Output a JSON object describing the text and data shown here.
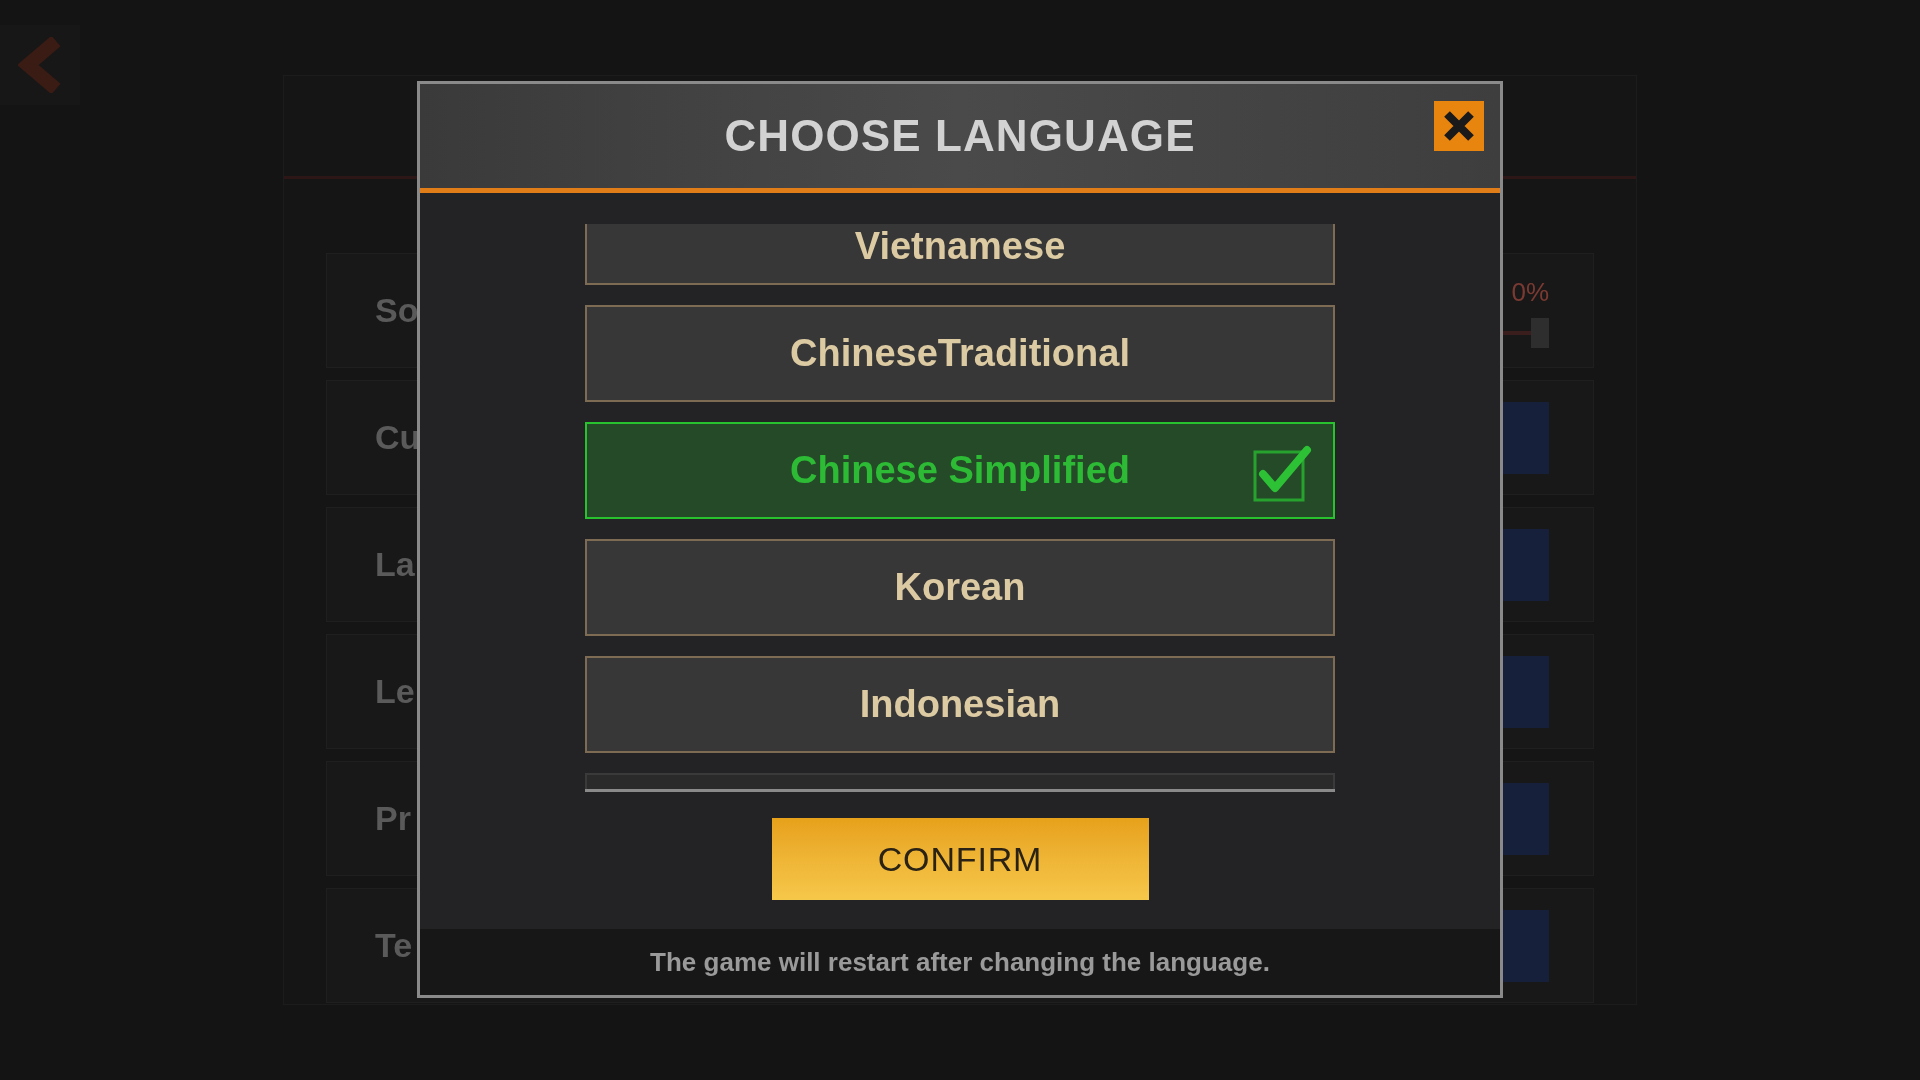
{
  "background_settings": {
    "rows": [
      {
        "label": "So",
        "kind": "slider",
        "reading": "0%",
        "level": 1
      },
      {
        "label": "Cu",
        "kind": "option"
      },
      {
        "label": "La",
        "kind": "option"
      },
      {
        "label": "Le",
        "kind": "option"
      },
      {
        "label": "Pr",
        "kind": "option"
      },
      {
        "label": "Te",
        "kind": "option"
      }
    ]
  },
  "dialog": {
    "title": "CHOOSE LANGUAGE",
    "languages": [
      {
        "label": "Vietnamese",
        "selected": false
      },
      {
        "label": "ChineseTraditional",
        "selected": false
      },
      {
        "label": "Chinese Simplified",
        "selected": true
      },
      {
        "label": "Korean",
        "selected": false
      },
      {
        "label": "Indonesian",
        "selected": false
      }
    ],
    "confirm": "CONFIRM",
    "note": "The game will restart after changing the language."
  }
}
